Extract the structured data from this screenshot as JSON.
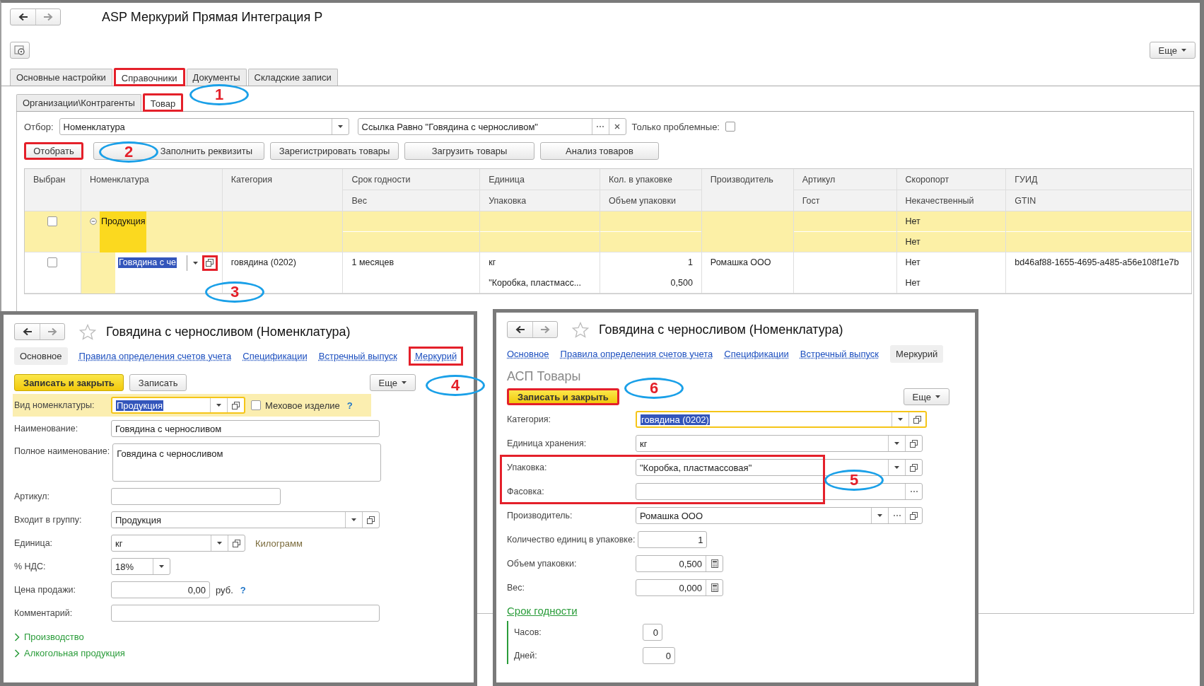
{
  "main_window": {
    "title": "ASP Меркурий Прямая Интеграция Р",
    "more_button": "Еще",
    "tabs": [
      {
        "label": "Основные настройки",
        "selected": false,
        "marked": false
      },
      {
        "label": "Справочники",
        "selected": true,
        "marked": true
      },
      {
        "label": "Документы",
        "selected": false,
        "marked": false
      },
      {
        "label": "Складские записи",
        "selected": false,
        "marked": false
      }
    ],
    "subtabs": [
      {
        "label": "Организации\\Контрагенты",
        "selected": false,
        "marked": false
      },
      {
        "label": "Товар",
        "selected": true,
        "marked": true
      }
    ],
    "filter": {
      "label": "Отбор:",
      "field": "Номенклатура",
      "condition": "Ссылка Равно \"Говядина с черносливом\"",
      "problems_label": "Только проблемные:",
      "problems_checked": false
    },
    "buttons": [
      {
        "label": "Отобрать",
        "marked": true
      },
      {
        "label": "Заполнить реквизиты",
        "marked": false
      },
      {
        "label": "Зарегистрировать товары",
        "marked": false
      },
      {
        "label": "Загрузить товары",
        "marked": false
      },
      {
        "label": "Анализ товаров",
        "marked": false
      }
    ],
    "table": {
      "columns": [
        {
          "top": "Выбран"
        },
        {
          "top": "Номенклатура"
        },
        {
          "top": "Категория"
        },
        {
          "top": "Срок годности",
          "bottom": "Вес"
        },
        {
          "top": "Единица",
          "bottom": "Упаковка"
        },
        {
          "top": "Кол. в упаковке",
          "bottom": "Объем упаковки"
        },
        {
          "top": "Производитель"
        },
        {
          "top": "Артикул",
          "bottom": "Гост"
        },
        {
          "top": "Скоропорт",
          "bottom": "Некачественный"
        },
        {
          "top": "ГУИД",
          "bottom": "GTIN"
        }
      ],
      "rows": [
        {
          "kind": "group",
          "selected": true,
          "checked": false,
          "expanded": true,
          "name": "Продукция",
          "perishable": "Нет",
          "substandard": "Нет"
        },
        {
          "kind": "item",
          "selected": false,
          "checked": false,
          "editing": true,
          "open_marked": true,
          "name": "Говядина с че",
          "category": "говядина (0202)",
          "shelf_life": "1 месяцев",
          "unit": "кг",
          "package": "\"Коробка, пластмасс...",
          "per_pack": "1",
          "pack_volume": "0,500",
          "manufacturer": "Ромашка ООО",
          "perishable": "Нет",
          "substandard": "Нет",
          "guid": "bd46af88-1655-4695-a485-a56e108f1e7b"
        }
      ]
    }
  },
  "product_form": {
    "title": "Говядина с черносливом (Номенклатура)",
    "favorite": false,
    "tabs": [
      {
        "label": "Основное",
        "selected": true,
        "marked": false
      },
      {
        "label": "Правила определения счетов учета",
        "selected": false,
        "marked": false
      },
      {
        "label": "Спецификации",
        "selected": false,
        "marked": false
      },
      {
        "label": "Встречный выпуск",
        "selected": false,
        "marked": false
      },
      {
        "label": "Меркурий",
        "selected": false,
        "marked": true
      }
    ],
    "buttons": [
      {
        "kind": "primary",
        "label": "Записать и закрыть",
        "marked": false
      },
      {
        "kind": "normal",
        "label": "Записать",
        "marked": false
      },
      {
        "kind": "menu",
        "label": "Еще",
        "marked": false
      }
    ],
    "fields": [
      {
        "kind": "select",
        "label": "Вид номенклатуры:",
        "value": "Продукция",
        "focused": true,
        "highlighted": true,
        "dropdown": true,
        "open": true,
        "checkbox": {
          "label": "Меховое изделие",
          "checked": false
        },
        "help": "?"
      },
      {
        "kind": "text",
        "label": "Наименование:",
        "value": "Говядина с черносливом",
        "focused": false,
        "highlighted": false
      },
      {
        "kind": "textarea",
        "label": "Полное наименование:",
        "value": "Говядина с черносливом",
        "focused": false,
        "highlighted": false
      },
      {
        "kind": "text",
        "label": "Артикул:",
        "focused": false,
        "highlighted": false
      },
      {
        "kind": "select",
        "label": "Входит в группу:",
        "value": "Продукция",
        "focused": false,
        "highlighted": false,
        "dropdown": true,
        "open": true
      },
      {
        "kind": "select",
        "label": "Единица:",
        "value": "кг",
        "focused": false,
        "highlighted": false,
        "dropdown": true,
        "open": true,
        "note": "Килограмм"
      },
      {
        "kind": "select",
        "label": "% НДС:",
        "value": "18%",
        "focused": false,
        "highlighted": false,
        "dropdown": true
      },
      {
        "kind": "number",
        "label": "Цена продажи:",
        "value": "0,00",
        "focused": false,
        "highlighted": false,
        "suffix": "руб.",
        "help": "?"
      },
      {
        "kind": "text",
        "label": "Комментарий:",
        "focused": false,
        "highlighted": false
      }
    ],
    "groups": [
      {
        "label": "Производство",
        "expanded": false
      },
      {
        "label": "Алкогольная продукция",
        "expanded": false
      }
    ]
  },
  "mercury_form": {
    "title": "Говядина с черносливом (Номенклатура)",
    "favorite": false,
    "tabs": [
      {
        "label": "Основное",
        "selected": false,
        "marked": false
      },
      {
        "label": "Правила определения счетов учета",
        "selected": false,
        "marked": false
      },
      {
        "label": "Спецификации",
        "selected": false,
        "marked": false
      },
      {
        "label": "Встречный выпуск",
        "selected": false,
        "marked": false
      },
      {
        "label": "Меркурий",
        "selected": true,
        "marked": false
      }
    ],
    "section_title": "АСП Товары",
    "buttons": [
      {
        "kind": "primary",
        "label": "Записать и закрыть",
        "marked": true
      },
      {
        "kind": "menu",
        "label": "Еще",
        "marked": false
      }
    ],
    "fields": [
      {
        "kind": "select",
        "label": "Категория:",
        "value": "говядина (0202)",
        "focused": true,
        "marked": false,
        "dropdown": true,
        "open": true
      },
      {
        "kind": "select",
        "label": "Единица хранения:",
        "value": "кг",
        "focused": false,
        "marked": false,
        "dropdown": true,
        "open": true
      },
      {
        "kind": "select",
        "label": "Упаковка:",
        "value": "\"Коробка, пластмассовая\"",
        "focused": false,
        "marked": true,
        "dropdown": true,
        "open": true
      },
      {
        "kind": "text",
        "label": "Фасовка:",
        "focused": false,
        "marked": true,
        "choice": true
      },
      {
        "kind": "select",
        "label": "Производитель:",
        "value": "Ромашка ООО",
        "focused": false,
        "marked": false,
        "dropdown": true,
        "choice": true,
        "open": true
      },
      {
        "kind": "number",
        "label": "Количество единиц в упаковке:",
        "value": "1",
        "focused": false,
        "marked": false
      },
      {
        "kind": "number",
        "label": "Объем упаковки:",
        "value": "0,500",
        "focused": false,
        "marked": false,
        "calculator": true
      },
      {
        "kind": "number",
        "label": "Вес:",
        "value": "0,000",
        "focused": false,
        "marked": false,
        "calculator": true
      }
    ],
    "shelf_life": {
      "label": "Срок годности",
      "fields": [
        {
          "label": "Часов:",
          "value": "0"
        },
        {
          "label": "Дней:",
          "value": "0"
        }
      ]
    }
  },
  "callouts": [
    {
      "number": "1"
    },
    {
      "number": "2"
    },
    {
      "number": "3"
    },
    {
      "number": "4"
    },
    {
      "number": "5"
    },
    {
      "number": "6"
    }
  ]
}
